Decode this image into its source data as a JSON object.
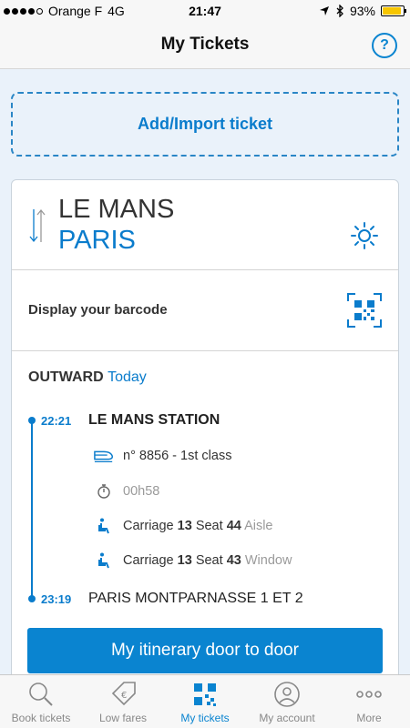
{
  "status_bar": {
    "carrier": "Orange F",
    "network": "4G",
    "time": "21:47",
    "battery_percent": "93%",
    "battery_level": 0.93
  },
  "nav": {
    "title": "My Tickets",
    "help_label": "?"
  },
  "add_import": {
    "label": "Add/Import ticket"
  },
  "ticket": {
    "from_city": "LE MANS",
    "to_city": "PARIS",
    "barcode_label": "Display your barcode",
    "outward_label": "OUTWARD",
    "outward_day": "Today",
    "departure": {
      "time": "22:21",
      "station": "LE MANS STATION"
    },
    "train": "n° 8856 - 1st class",
    "duration": "00h58",
    "seats": [
      {
        "carriage_label": "Carriage",
        "carriage": "13",
        "seat_label": "Seat",
        "seat": "44",
        "position": "Aisle"
      },
      {
        "carriage_label": "Carriage",
        "carriage": "13",
        "seat_label": "Seat",
        "seat": "43",
        "position": "Window"
      }
    ],
    "arrival": {
      "time": "23:19",
      "station": "PARIS MONTPARNASSE 1 ET 2"
    },
    "itinerary_button": "My itinerary door to door"
  },
  "tabs": [
    {
      "label": "Book tickets",
      "icon": "search-icon",
      "active": false
    },
    {
      "label": "Low fares",
      "icon": "price-tag-icon",
      "active": false
    },
    {
      "label": "My tickets",
      "icon": "qr-ticket-icon",
      "active": true
    },
    {
      "label": "My account",
      "icon": "account-icon",
      "active": false
    },
    {
      "label": "More",
      "icon": "more-dots-icon",
      "active": false
    }
  ],
  "colors": {
    "accent": "#0a84d0",
    "background": "#eaf2fa",
    "battery": "#f7c600"
  }
}
